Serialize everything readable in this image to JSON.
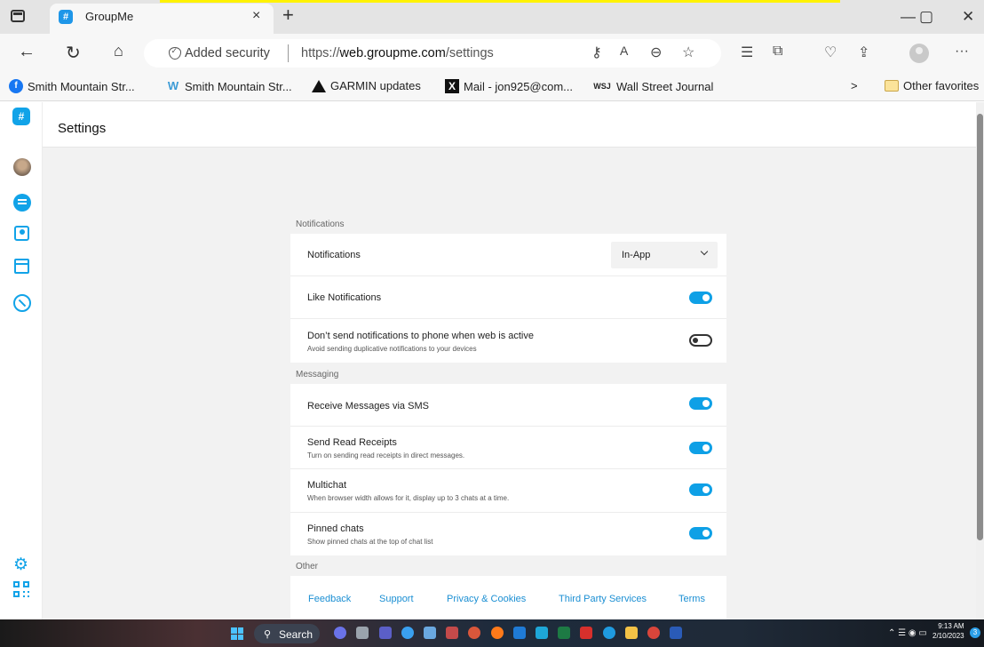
{
  "browser": {
    "tab_title": "GroupMe",
    "tab_close": "×",
    "new_tab": "+",
    "security_label": "Added security",
    "url_prefix": "https://",
    "url_host": "web.groupme.com",
    "url_path": "/settings",
    "window_minimize": "—",
    "window_restore": "▢",
    "window_close": "✕",
    "more_menu": "···"
  },
  "bookmarks": [
    {
      "label": "Smith Mountain Str...",
      "icon": "facebook-icon"
    },
    {
      "label": "Smith Mountain Str...",
      "icon": "wix-icon"
    },
    {
      "label": "GARMIN updates",
      "icon": "garmin-icon"
    },
    {
      "label": "Mail - jon925@com...",
      "icon": "x-mail-icon"
    },
    {
      "label": "Wall Street Journal",
      "icon": "wsj-icon",
      "icon_text": "WSJ"
    }
  ],
  "bookmarks_overflow": ">",
  "other_favorites": "Other favorites",
  "app": {
    "logo_text": "#",
    "page_title": "Settings",
    "accent_color": "#11a3e8"
  },
  "settings": {
    "notifications_section": "Notifications",
    "notifications_label": "Notifications",
    "notifications_value": "In-App",
    "like_notifications": {
      "label": "Like Notifications",
      "enabled": true
    },
    "dont_send": {
      "label": "Don’t send notifications to phone when web is active",
      "description": "Avoid sending duplicative notifications to your devices",
      "enabled": false
    },
    "messaging_section": "Messaging",
    "sms": {
      "label": "Receive Messages via SMS",
      "enabled": true
    },
    "read_receipts": {
      "label": "Send Read Receipts",
      "description": "Turn on sending read receipts in direct messages.",
      "enabled": true
    },
    "multichat": {
      "label": "Multichat",
      "description": "When browser width allows for it, display up to 3 chats at a time.",
      "enabled": true
    },
    "pinned": {
      "label": "Pinned chats",
      "description": "Show pinned chats at the top of chat list",
      "enabled": true
    },
    "other_section": "Other"
  },
  "footer_links": [
    "Feedback",
    "Support",
    "Privacy & Cookies",
    "Third Party Services",
    "Terms"
  ],
  "taskbar": {
    "search_label": "Search",
    "time": "9:13 AM",
    "date": "2/10/2023",
    "notification_count": "3"
  }
}
